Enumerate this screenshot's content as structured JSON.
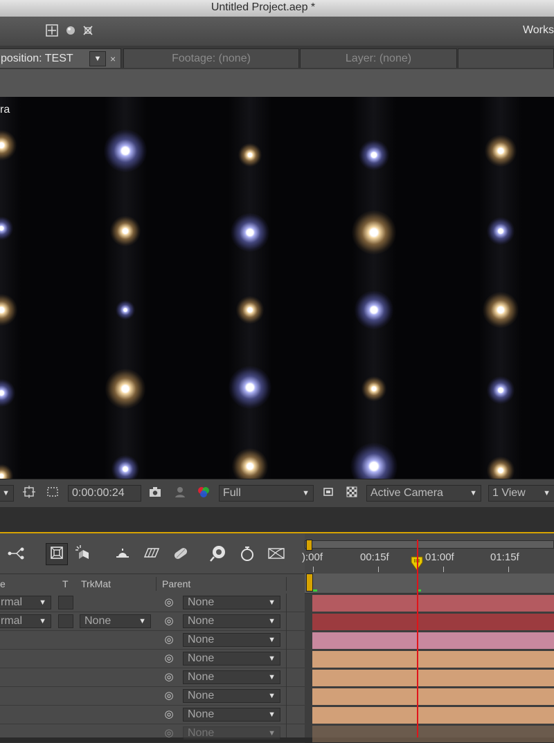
{
  "window": {
    "title": "Untitled Project.aep *"
  },
  "toolbar": {
    "workspace_label": "Works"
  },
  "panel_tabs": [
    {
      "label": "position: TEST",
      "active": true
    },
    {
      "label": "Footage: (none)",
      "active": false
    },
    {
      "label": "Layer: (none)",
      "active": false
    }
  ],
  "viewer": {
    "camera_label": "ra"
  },
  "viewer_controls": {
    "timecode": "0:00:00:24",
    "resolution": "Full",
    "camera": "Active Camera",
    "views": "1 View"
  },
  "timeline": {
    "ruler_labels": [
      "):00f",
      "00:15f",
      "01:00f",
      "01:15f"
    ],
    "columns": {
      "mode": "e",
      "t": "T",
      "trkmat": "TrkMat",
      "parent": "Parent"
    },
    "rows": [
      {
        "mode": "rmal",
        "trkmat": "",
        "parent": "None",
        "bar_color": "#b45a60"
      },
      {
        "mode": "rmal",
        "trkmat": "None",
        "parent": "None",
        "bar_color": "#9c3b3f"
      },
      {
        "mode": "",
        "trkmat": "",
        "parent": "None",
        "bar_color": "#c9889e"
      },
      {
        "mode": "",
        "trkmat": "",
        "parent": "None",
        "bar_color": "#d2a078"
      },
      {
        "mode": "",
        "trkmat": "",
        "parent": "None",
        "bar_color": "#d2a078"
      },
      {
        "mode": "",
        "trkmat": "",
        "parent": "None",
        "bar_color": "#d2a078"
      },
      {
        "mode": "",
        "trkmat": "",
        "parent": "None",
        "bar_color": "#d2a078"
      },
      {
        "mode": "",
        "trkmat": "",
        "parent": "None",
        "bar_color": "#8a7058"
      }
    ]
  },
  "colors": {
    "playhead": "#e0141a",
    "work_area_accent": "#d7a300"
  }
}
